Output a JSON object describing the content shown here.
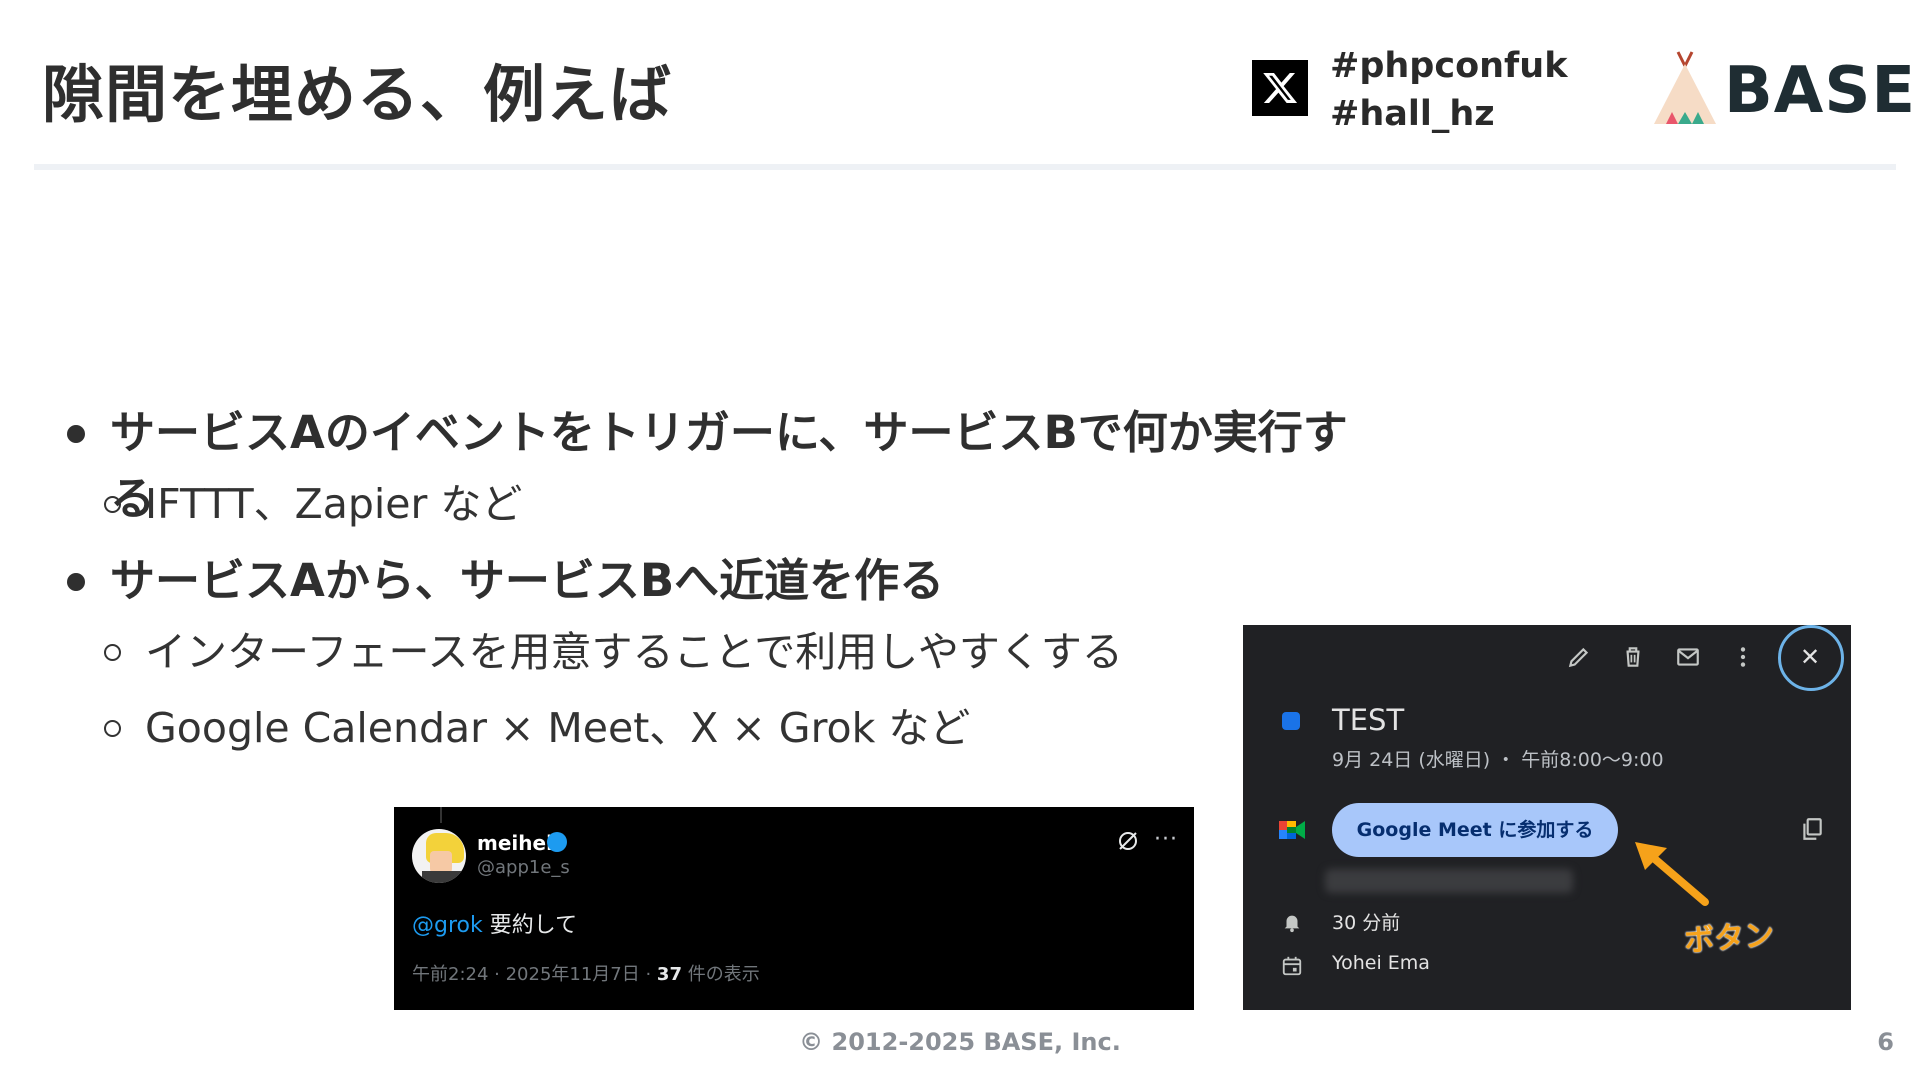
{
  "header": {
    "title": "隙間を埋める、例えば",
    "hashtags": [
      "#phpconfuk",
      "#hall_hz"
    ],
    "brand": "BASE",
    "x_icon": "x-logo-icon"
  },
  "bullets": [
    {
      "text": "サービスAのイベントをトリガーに、サービスBで何か実行する",
      "sub": [
        "IFTTT、Zapier など"
      ]
    },
    {
      "text": "サービスAから、サービスBへ近道を作る",
      "sub": [
        "インターフェースを用意することで利用しやすくする",
        "Google Calendar × Meet、X × Grok など"
      ]
    }
  ],
  "tweet": {
    "name": "meihei",
    "handle": "@app1e_s",
    "mention": "@grok",
    "body": " 要約して",
    "meta_prefix": "午前2:24 · 2025年11月7日 · ",
    "views": "37",
    "views_suffix": " 件の表示",
    "more": "···"
  },
  "calendar": {
    "title": "TEST",
    "date": "9月 24日 (水曜日) ・ 午前8:00〜9:00",
    "meet_button": "Google Meet に参加する",
    "notification": "30 分前",
    "owner": "Yohei Ema",
    "callout": "ボタン",
    "accent": "#a8c7fa"
  },
  "footer": {
    "copyright": "© 2012-2025 BASE, Inc.",
    "page": "6"
  }
}
